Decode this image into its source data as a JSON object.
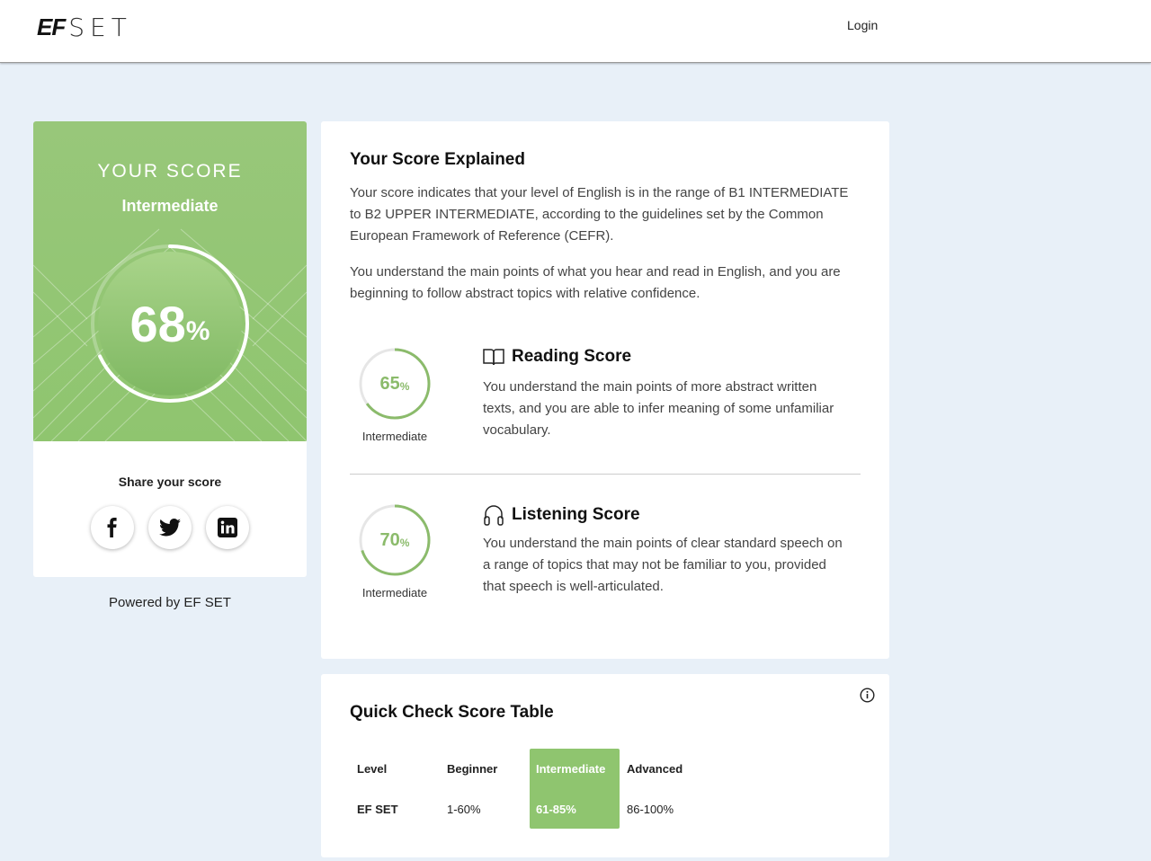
{
  "header": {
    "logo_ef": "EF",
    "logo_set": "SET",
    "login_label": "Login"
  },
  "score_card": {
    "title": "YOUR SCORE",
    "level": "Intermediate",
    "percent": "68",
    "percent_value": 68,
    "percent_sign": "%",
    "share_title": "Share your score",
    "social": [
      "facebook-icon",
      "twitter-icon",
      "linkedin-icon"
    ]
  },
  "powered_by": "Powered by EF SET",
  "explained": {
    "title": "Your Score Explained",
    "para1_line1": "Your score indicates that your level of English is in the range of B1 INTERMEDIATE",
    "para1_line2": "to B2 UPPER INTERMEDIATE, according to the guidelines set by the Common",
    "para1_line3": "European Framework of Reference (CEFR).",
    "para2_line1": "You understand the main points of what you hear and read in English, and you are",
    "para2_line2": "beginning to follow abstract topics with relative confidence.",
    "reading": {
      "title": "Reading Score",
      "percent": "65",
      "percent_value": 65,
      "percent_sign": "%",
      "level": "Intermediate",
      "line1": "You understand the main points of more abstract written",
      "line2": "texts, and you are able to infer meaning of some unfamiliar",
      "line3": "vocabulary."
    },
    "listening": {
      "title": "Listening Score",
      "percent": "70",
      "percent_value": 70,
      "percent_sign": "%",
      "level": "Intermediate",
      "line1": "You understand the main points of clear standard speech on",
      "line2": "a range of topics that may not be familiar to you, provided",
      "line3": "that speech is well-articulated."
    }
  },
  "quick_check": {
    "title": "Quick Check Score Table",
    "headers": [
      "Level",
      "Beginner",
      "Intermediate",
      "Advanced"
    ],
    "row": [
      "EF SET",
      "1-60%",
      "61-85%",
      "86-100%"
    ],
    "highlighted": "Intermediate"
  },
  "colors": {
    "accent_green": "#8fc56f",
    "background": "#e8f0f8"
  }
}
